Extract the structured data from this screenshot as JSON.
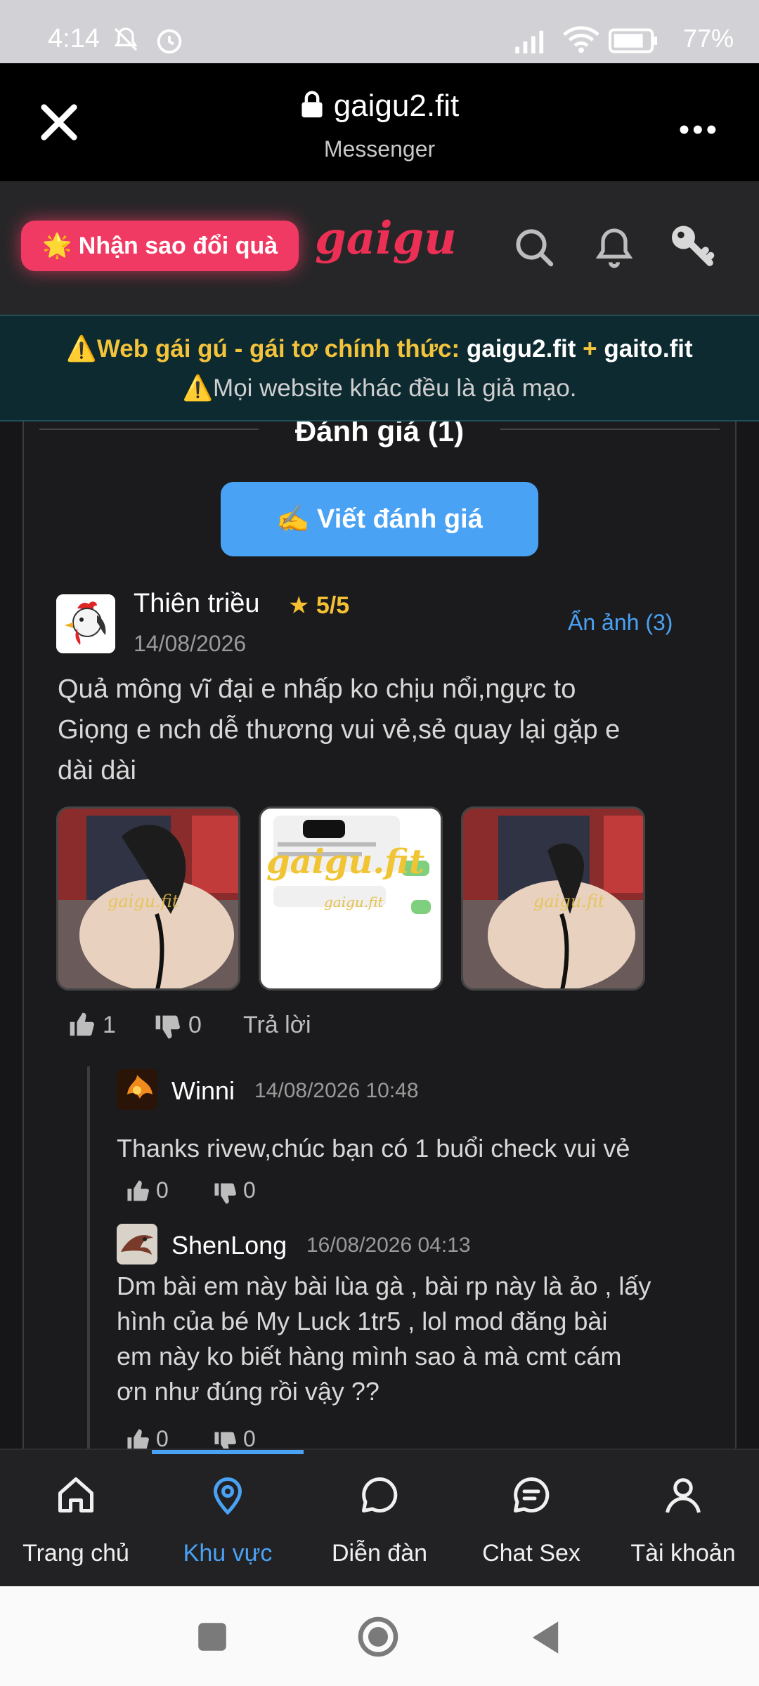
{
  "status_bar": {
    "time": "4:14",
    "battery": "77%"
  },
  "browser": {
    "domain": "gaigu2.fit",
    "subtitle": "Messenger"
  },
  "header": {
    "promo_label": "🌟 Nhận sao đổi quà",
    "logo": "gaigu"
  },
  "warning": {
    "line1_prefix": "⚠️Web gái gú - gái tơ chính thức: ",
    "line1_site1": "gaigu2.fit",
    "line1_plus": " + ",
    "line1_site2": "gaito.fit",
    "line2": "⚠️Mọi website khác đều là giả mạo."
  },
  "reviews": {
    "section_title": "Đánh giá (1)",
    "write_button": "✍️ Viết đánh giá",
    "review": {
      "author": "Thiên triều",
      "rating": "★ 5/5",
      "date": "14/08/2026",
      "hide_images": "Ẩn ảnh (3)",
      "body": [
        "Quả mông vĩ đại e nhấp ko chịu nổi,ngực to",
        "Giọng e nch dễ thương vui vẻ,sẻ quay lại gặp e",
        "dài dài"
      ],
      "thumb_watermark": "gaigu.fit",
      "likes": "1",
      "dislikes": "0",
      "reply_label": "Trả lời"
    },
    "replies": [
      {
        "author": "Winni",
        "date": "14/08/2026 10:48",
        "body": [
          "Thanks rivew,chúc bạn có 1 buổi check vui vẻ"
        ],
        "likes": "0",
        "dislikes": "0"
      },
      {
        "author": "ShenLong",
        "date": "16/08/2026 04:13",
        "body": [
          "Dm bài em này bài lùa gà , bài rp này là ảo , lấy",
          "hình của bé My Luck 1tr5 , lol mod đăng bài",
          "em này ko biết hàng mình sao à mà cmt cám",
          "ơn như đúng rồi vậy ??"
        ],
        "likes": "0",
        "dislikes": "0"
      }
    ]
  },
  "nav": {
    "items": [
      {
        "label": "Trang chủ",
        "icon": "home-icon"
      },
      {
        "label": "Khu vực",
        "icon": "location-pin-icon"
      },
      {
        "label": "Diễn đàn",
        "icon": "chat-bubble-icon"
      },
      {
        "label": "Chat Sex",
        "icon": "message-lines-icon"
      },
      {
        "label": "Tài khoản",
        "icon": "user-icon"
      }
    ],
    "active_index": 1
  },
  "colors": {
    "accent": "#4aa2f5",
    "brand": "#ec2f55",
    "warning_yellow": "#f3c33b",
    "rating_gold": "#f5c133"
  }
}
